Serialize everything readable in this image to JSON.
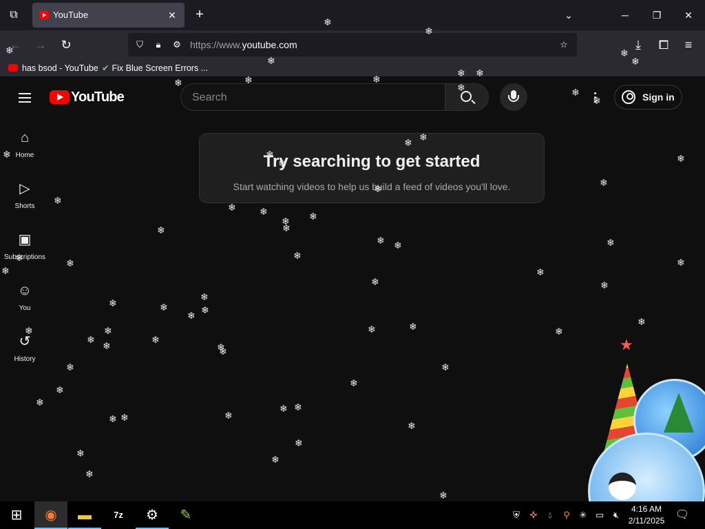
{
  "browser": {
    "tab_list_icon": "tab-list-icon",
    "tabs": [
      {
        "title": "YouTube",
        "favicon": "youtube-favicon-icon",
        "close_icon": "close-icon"
      }
    ],
    "new_tab_icon": "plus-icon",
    "tab_overflow_icon": "chevron-down-icon",
    "window_controls": {
      "minimize": "minimize-icon",
      "maximize": "restore-icon",
      "close": "close-icon"
    },
    "nav": {
      "back": "arrow-left-icon",
      "forward": "arrow-right-icon",
      "reload": "reload-icon"
    },
    "url": {
      "prefix": "https://www.",
      "domain": "youtube.com",
      "suffix": ""
    },
    "url_icons": [
      "shield-icon",
      "lock-icon",
      "permissions-icon",
      "star-icon"
    ],
    "toolbar_icons": [
      "download-icon",
      "extensions-icon",
      "menu-icon"
    ],
    "bookmarks": [
      {
        "label": "has bsod - YouTube",
        "icon": "youtube-favicon-icon"
      },
      {
        "label": "Fix Blue Screen Errors ...",
        "icon": "checkmark-icon"
      }
    ]
  },
  "youtube": {
    "logo_text": "YouTube",
    "search_placeholder": "Search",
    "sign_in_label": "Sign in",
    "guide": [
      {
        "label": "Home",
        "icon": "home-icon"
      },
      {
        "label": "Shorts",
        "icon": "shorts-icon"
      },
      {
        "label": "Subscriptions",
        "icon": "subscriptions-icon"
      },
      {
        "label": "You",
        "icon": "you-icon"
      },
      {
        "label": "History",
        "icon": "history-icon"
      }
    ],
    "empty_state": {
      "title": "Try searching to get started",
      "subtitle": "Start watching videos to help us build a feed of videos you'll love."
    }
  },
  "taskbar": {
    "apps": [
      "windows-start-icon",
      "firefox-icon",
      "file-explorer-icon",
      "7zip-icon",
      "settings-icon",
      "paint-icon"
    ],
    "tray_icons": [
      "security-icon",
      "network-warning-icon",
      "drop-icon",
      "search-tray-icon",
      "snowflake-tray-icon",
      "network-icon",
      "volume-muted-icon"
    ],
    "time": "4:16 AM",
    "date": "2/11/2025",
    "notification_icon": "notification-icon"
  },
  "colors": {
    "youtube_red": "#ff0000",
    "page_bg": "#0f0f0f",
    "browser_chrome": "#2b2a33",
    "titlebar": "#1c1b22"
  }
}
